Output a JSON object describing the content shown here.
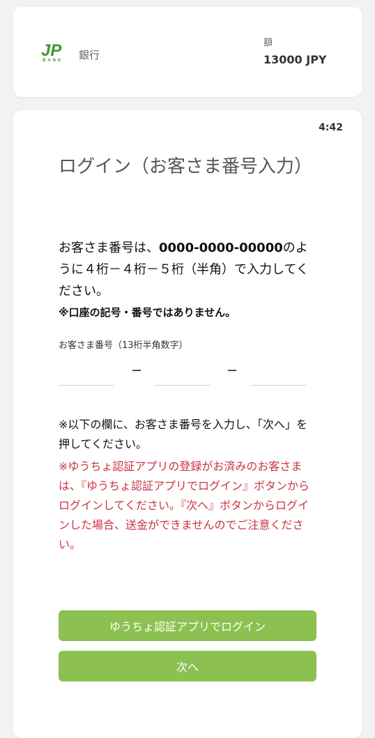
{
  "header": {
    "logo_text": "JP BANK",
    "bank_label": "銀行",
    "amount_label": "額",
    "amount_value": "13000 JPY"
  },
  "main": {
    "timer": "4:42",
    "title": "ログイン（お客さま番号入力）",
    "instructions_part1": "お客さま番号は、",
    "instructions_bold": "0000-0000-00000",
    "instructions_part2": "のように４桁－４桁－５桁（半角）で入力してください。",
    "note": "※口座の記号・番号ではありません。",
    "field_label": "お客さま番号（13桁半角数字）",
    "dash": "－",
    "segments": [
      {
        "value": "",
        "placeholder": ""
      },
      {
        "value": "",
        "placeholder": ""
      },
      {
        "value": "",
        "placeholder": ""
      }
    ],
    "instruction2": "※以下の欄に、お客さま番号を入力し、「次へ」を押してください。",
    "warning": "※ゆうちょ認証アプリの登録がお済みのお客さまは、『ゆうちょ認証アプリでログイン』ボタンからログインしてください。『次へ』ボタンからログインした場合、送金ができませんのでご注意ください。",
    "btn_app_label": "ゆうちょ認証アプリでログイン",
    "btn_next_label": "次へ"
  },
  "colors": {
    "accent_green": "#8cc152",
    "warning_red": "#cc3344",
    "logo_green": "#3a9a2a"
  }
}
